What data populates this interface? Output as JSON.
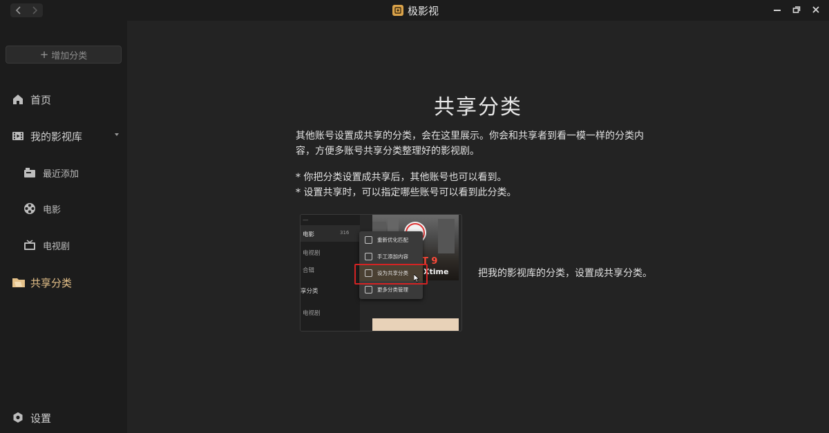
{
  "window": {
    "app_title": "极影视",
    "back_icon": "chevron-left-icon",
    "forward_icon": "chevron-right-icon",
    "controls": [
      "minimize-icon",
      "restore-icon",
      "close-icon"
    ]
  },
  "sidebar": {
    "add_category_label": "增加分类",
    "items": [
      {
        "label": "首页",
        "icon": "home-icon"
      },
      {
        "label": "我的影视库",
        "icon": "film-strip-icon",
        "expandable": true
      },
      {
        "label": "最近添加",
        "icon": "recent-added-icon",
        "sub": true
      },
      {
        "label": "电影",
        "icon": "film-reel-icon",
        "sub": true
      },
      {
        "label": "电视剧",
        "icon": "tv-icon",
        "sub": true
      },
      {
        "label": "共享分类",
        "icon": "shared-folder-icon",
        "active": true
      }
    ],
    "settings_label": "设置"
  },
  "main": {
    "title": "共享分类",
    "description": "其他账号设置成共享的分类，会在这里展示。你会和共享者到看一模一样的分类内容，方便多账号共享分类整理好的影视剧。",
    "bullets": [
      "* 你把分类设置成共享后，其他账号也可以看到。",
      "* 设置共享时，可以指定哪些账号可以看到此分类。"
    ],
    "illustration": {
      "sidebar_items": [
        "电影",
        "316",
        "电视剧",
        "合辑",
        "享分类",
        "电视剧"
      ],
      "menu_items": [
        "重新优化匹配",
        "手工添加内容",
        "设为共享分类",
        "更多分类管理"
      ],
      "poster_text": "T 9",
      "poster_text2": "Xtime",
      "caption": "把我的影视库的分类，设置成共享分类。"
    }
  },
  "colors": {
    "accent": "#e6c28a",
    "highlight_border": "#d42323",
    "sidebar_bg": "#1c1c1c",
    "main_bg": "#232323"
  }
}
